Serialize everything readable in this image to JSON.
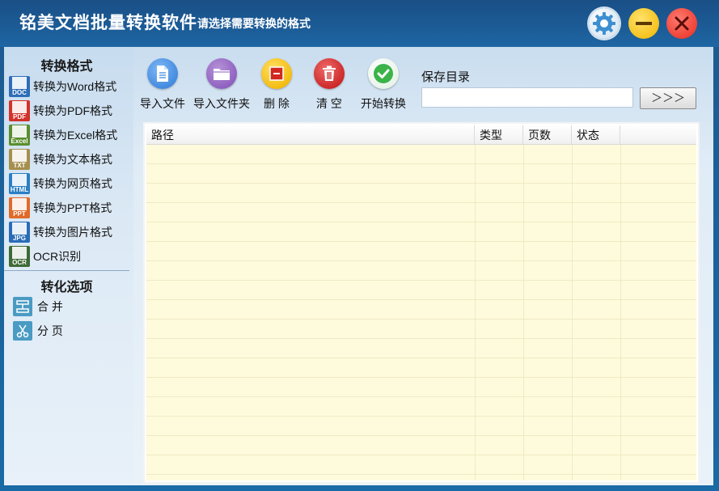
{
  "window": {
    "title": "铭美文档批量转换软件",
    "subtitle": "请选择需要转换的格式"
  },
  "sidebar": {
    "format_section_title": "转换格式",
    "formats": [
      {
        "label": "转换为Word格式",
        "icon": "doc-icon",
        "tag": "DOC"
      },
      {
        "label": "转换为PDF格式",
        "icon": "pdf-icon",
        "tag": "PDF"
      },
      {
        "label": "转换为Excel格式",
        "icon": "excel-icon",
        "tag": "Excel"
      },
      {
        "label": "转换为文本格式",
        "icon": "txt-icon",
        "tag": "TXT"
      },
      {
        "label": "转换为网页格式",
        "icon": "html-icon",
        "tag": "HTML"
      },
      {
        "label": "转换为PPT格式",
        "icon": "ppt-icon",
        "tag": "PPT"
      },
      {
        "label": "转换为图片格式",
        "icon": "jpg-icon",
        "tag": "JPG"
      },
      {
        "label": "OCR识别",
        "icon": "ocr-icon",
        "tag": "OCR"
      }
    ],
    "options_section_title": "转化选项",
    "options": [
      {
        "label": "合 并",
        "icon": "merge-icon"
      },
      {
        "label": "分 页",
        "icon": "scissors-icon"
      }
    ]
  },
  "toolbar": {
    "import_file": "导入文件",
    "import_folder": "导入文件夹",
    "delete": "删 除",
    "clear": "清 空",
    "start": "开始转换"
  },
  "save": {
    "label": "保存目录",
    "value": "",
    "browse_label": "＞＞＞"
  },
  "table": {
    "columns": [
      "路径",
      "类型",
      "页数",
      "状态"
    ],
    "rows": []
  },
  "colors": {
    "titlebar": "#1c5c97",
    "table_bg": "#fefbdc",
    "close": "#ef4236",
    "minimize": "#f6c21e"
  }
}
